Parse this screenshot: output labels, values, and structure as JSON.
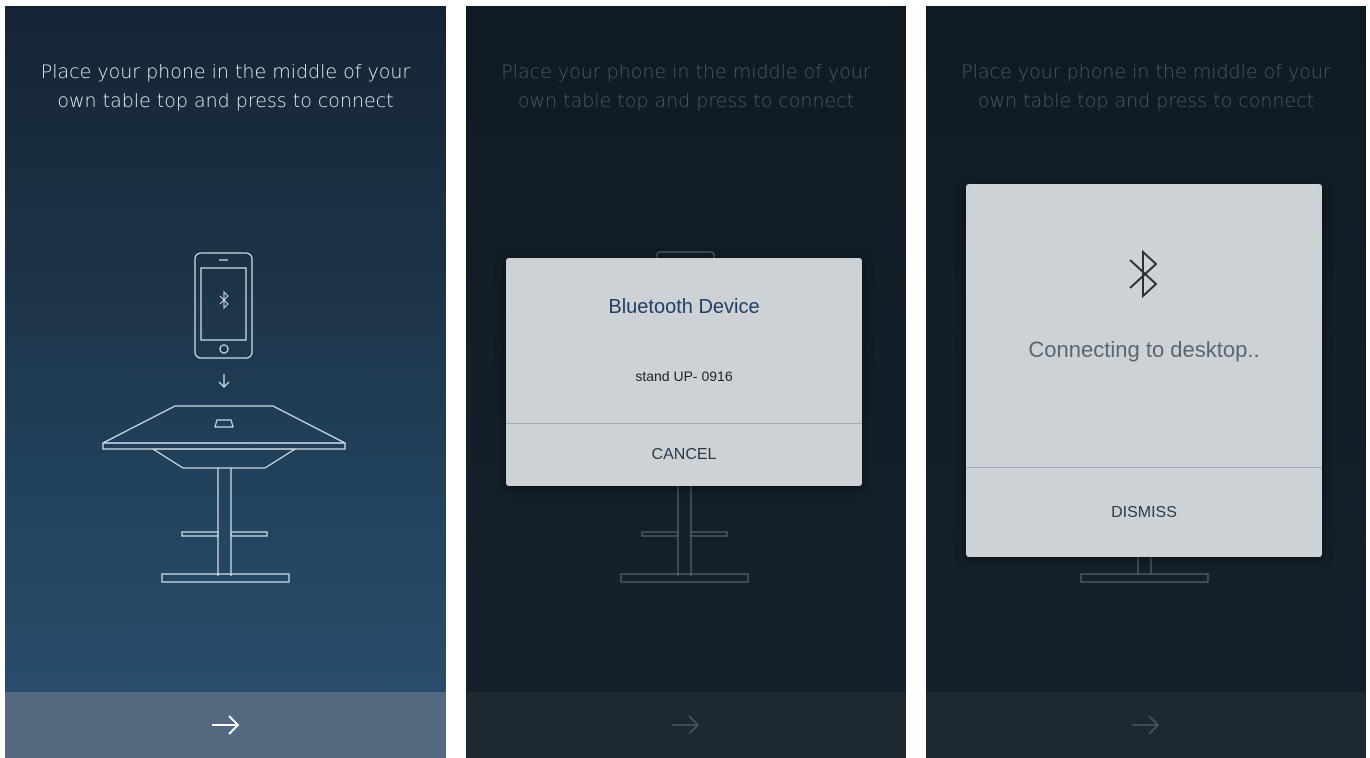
{
  "screens": [
    {
      "instruction": "Place your phone in the middle of your own table top and press to connect",
      "next_icon": "arrow-right-icon"
    },
    {
      "instruction": "Place your phone in the middle of your own table top and press to connect",
      "dialog": {
        "title": "Bluetooth Device",
        "device": "stand UP- 0916",
        "button": "CANCEL"
      },
      "next_icon": "arrow-right-icon"
    },
    {
      "instruction": "Place your phone in the middle of your own table top and press to connect",
      "dialog": {
        "icon": "bluetooth-icon",
        "message": "Connecting to desktop..",
        "button": "DISMISS"
      },
      "next_icon": "arrow-right-icon"
    }
  ],
  "colors": {
    "screen1_bg": "#1c3347",
    "overlay_bg": "#121e28",
    "dialog_bg": "#cdd2d6",
    "title_blue": "#1f3f66",
    "bottom_bar_active": "#52697f"
  }
}
